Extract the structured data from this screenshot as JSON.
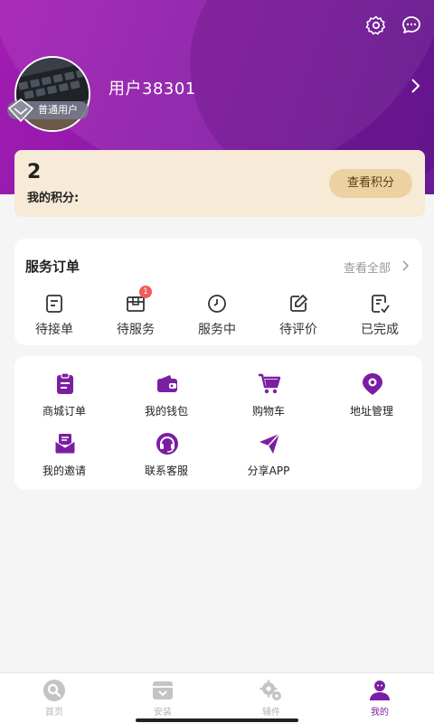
{
  "header": {
    "settings_icon": "gear-icon",
    "message_icon": "chat-bubble-icon",
    "username": "用户38301",
    "member_badge": "普通用户"
  },
  "points": {
    "value": "2",
    "label": "我的积分:",
    "button": "查看积分"
  },
  "orders": {
    "title": "服务订单",
    "view_all": "查看全部",
    "items": [
      {
        "label": "待接单",
        "icon": "document-icon"
      },
      {
        "label": "待服务",
        "icon": "box-icon",
        "badge": "1"
      },
      {
        "label": "服务中",
        "icon": "clock-icon"
      },
      {
        "label": "待评价",
        "icon": "edit-icon"
      },
      {
        "label": "已完成",
        "icon": "check-document-icon"
      }
    ]
  },
  "tools": [
    {
      "label": "商城订单",
      "icon": "clipboard-icon"
    },
    {
      "label": "我的钱包",
      "icon": "wallet-icon"
    },
    {
      "label": "购物车",
      "icon": "cart-icon"
    },
    {
      "label": "地址管理",
      "icon": "location-icon"
    },
    {
      "label": "我的邀请",
      "icon": "mail-icon"
    },
    {
      "label": "联系客服",
      "icon": "headset-icon"
    },
    {
      "label": "分享APP",
      "icon": "send-icon"
    }
  ],
  "tabbar": [
    {
      "label": "首页",
      "icon": "home-search-icon",
      "active": false
    },
    {
      "label": "安装",
      "icon": "install-box-icon",
      "active": false
    },
    {
      "label": "辅件",
      "icon": "gears-icon",
      "active": false
    },
    {
      "label": "我的",
      "icon": "user-icon",
      "active": true
    }
  ],
  "colors": {
    "brand": "#7b1fa2",
    "header_start": "#a21bb2",
    "points_bg": "#f7ead6",
    "badge_red": "#ef5b5b"
  }
}
